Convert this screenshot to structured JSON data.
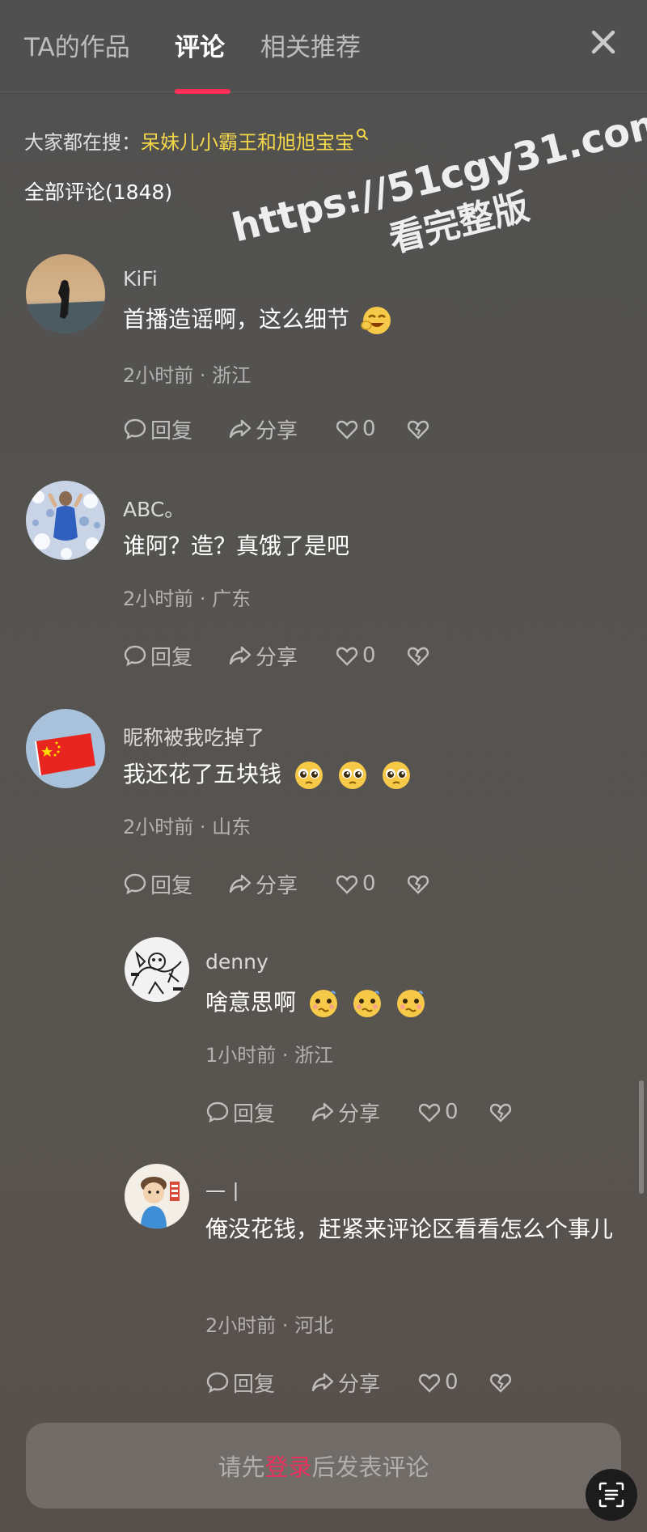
{
  "tabs": [
    {
      "label": "TA的作品"
    },
    {
      "label": "评论"
    },
    {
      "label": "相关推荐"
    }
  ],
  "search": {
    "prefix": "大家都在搜：",
    "keyword": "呆妹儿小霸王和旭旭宝宝"
  },
  "comment_count_label": "全部评论(1848)",
  "watermark": {
    "line1": "https://51cgy31.com",
    "line2": "看完整版"
  },
  "actions": {
    "reply": "回复",
    "share": "分享"
  },
  "comments": [
    {
      "username": "KiFi",
      "text": "首播造谣啊，这么细节",
      "emojis": [
        "laugh-emoji"
      ],
      "time": "2小时前",
      "location": "浙江",
      "likes": "0"
    },
    {
      "username": "ABC。",
      "text": "谁阿？造？真饿了是吧",
      "emojis": [],
      "time": "2小时前",
      "location": "广东",
      "likes": "0"
    },
    {
      "username": "昵称被我吃掉了",
      "text": "我还花了五块钱",
      "emojis": [
        "pleading-emoji",
        "pleading-emoji",
        "pleading-emoji"
      ],
      "time": "2小时前",
      "location": "山东",
      "likes": "0"
    },
    {
      "username": "denny",
      "text": "啥意思啊",
      "emojis": [
        "confused-emoji",
        "confused-emoji",
        "confused-emoji"
      ],
      "time": "1小时前",
      "location": "浙江",
      "likes": "0"
    },
    {
      "username": "一丨",
      "text": "俺没花钱，赶紧来评论区看看怎么个事儿",
      "emojis": [],
      "time": "2小时前",
      "location": "河北",
      "likes": "0"
    }
  ],
  "meta_separator": " · ",
  "input": {
    "prefix": "请先",
    "login": "登录",
    "suffix": "后发表评论"
  },
  "colors": {
    "accent": "#fe2c55",
    "keyword": "#f5d84a"
  }
}
